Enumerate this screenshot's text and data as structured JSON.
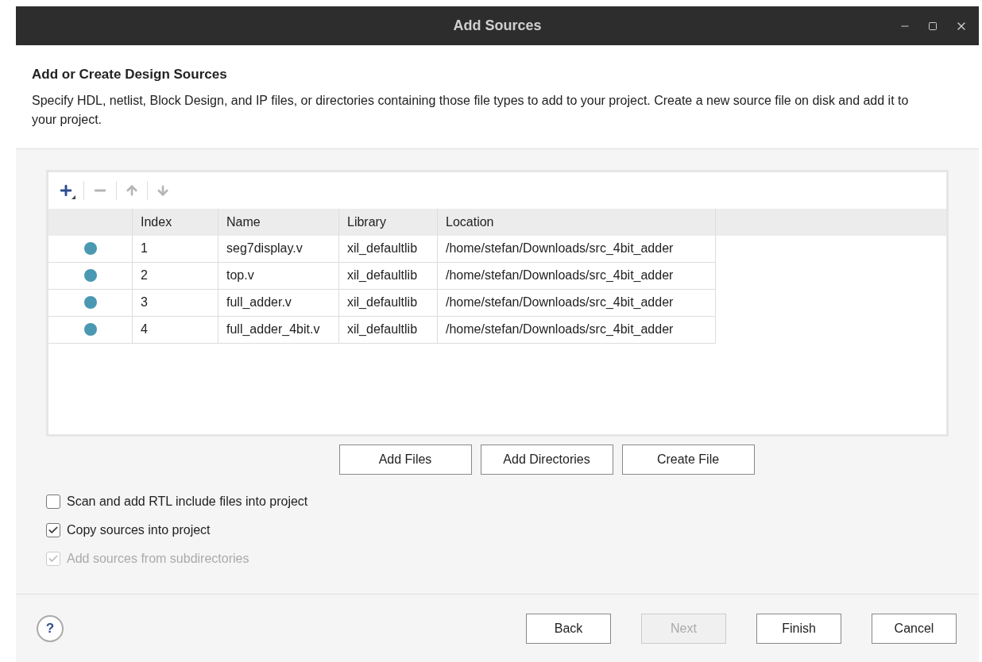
{
  "window": {
    "title": "Add Sources"
  },
  "header": {
    "title": "Add or Create Design Sources",
    "description": "Specify HDL, netlist, Block Design, and IP files, or directories containing those file types to add to your project. Create a new source file on disk and add it to your project."
  },
  "toolbar": [
    {
      "kind": "add",
      "disabled": false
    },
    {
      "kind": "remove",
      "disabled": true
    },
    {
      "kind": "up",
      "disabled": true
    },
    {
      "kind": "down",
      "disabled": true
    }
  ],
  "table": {
    "columns": [
      "Index",
      "Name",
      "Library",
      "Location"
    ],
    "rows": [
      {
        "color": "#4a98b2",
        "cells": [
          "1",
          "seg7display.v",
          "xil_defaultlib",
          "/home/stefan/Downloads/src_4bit_adder"
        ]
      },
      {
        "color": "#4a98b2",
        "cells": [
          "2",
          "top.v",
          "xil_defaultlib",
          "/home/stefan/Downloads/src_4bit_adder"
        ]
      },
      {
        "color": "#4a98b2",
        "cells": [
          "3",
          "full_adder.v",
          "xil_defaultlib",
          "/home/stefan/Downloads/src_4bit_adder"
        ]
      },
      {
        "color": "#4a98b2",
        "cells": [
          "4",
          "full_adder_4bit.v",
          "xil_defaultlib",
          "/home/stefan/Downloads/src_4bit_adder"
        ]
      }
    ]
  },
  "table_buttons": [
    "Add Files",
    "Add Directories",
    "Create File"
  ],
  "options": [
    {
      "label": "Scan and add RTL include files into project",
      "checked": false,
      "disabled": false
    },
    {
      "label": "Copy sources into project",
      "checked": true,
      "disabled": false
    },
    {
      "label": "Add sources from subdirectories",
      "checked": true,
      "disabled": true
    }
  ],
  "help": "?",
  "footer_buttons": [
    {
      "label": "Back",
      "disabled": false
    },
    {
      "label": "Next",
      "disabled": true
    },
    {
      "label": "Finish",
      "disabled": false
    },
    {
      "label": "Cancel",
      "disabled": false
    }
  ]
}
